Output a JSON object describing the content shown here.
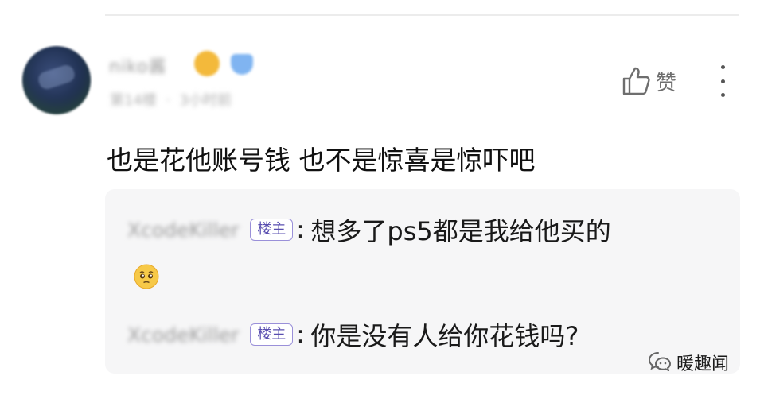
{
  "comment": {
    "username": "niko酱",
    "meta": "第14楼  ·  3小时前",
    "like_label": "赞",
    "text": "也是花他账号钱 也不是惊喜是惊吓吧"
  },
  "replies": [
    {
      "author": "XcodeKiller",
      "badge": "楼主",
      "colon": ":",
      "text": "想多了ps5都是我给他买的",
      "emoji": "pleading-face"
    },
    {
      "author": "XcodeKiller",
      "badge": "楼主",
      "colon": ":",
      "text": "你是没有人给你花钱吗?"
    }
  ],
  "watermark": {
    "text": "暖趣闻",
    "icon": "wechat-official-account-icon"
  },
  "colors": {
    "badge_text": "#5a4fb0",
    "badge_border": "#9a90d9",
    "reply_bg": "#f6f6f7",
    "verified": "#6aa8ef"
  }
}
